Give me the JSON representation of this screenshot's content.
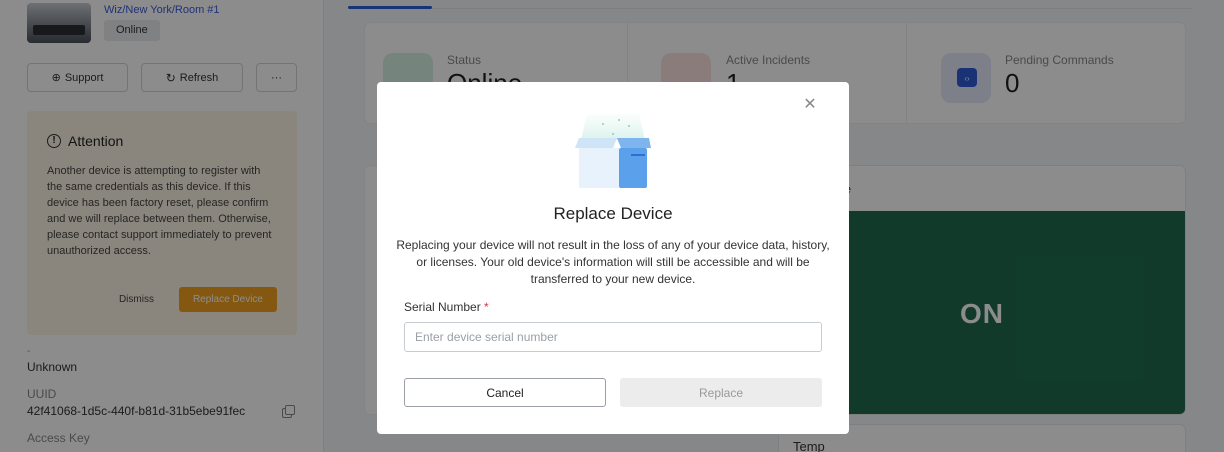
{
  "sidebar": {
    "location_link": "Wiz/New York/Room #1",
    "status_pill": "Online",
    "buttons": {
      "support": "Support",
      "refresh": "Refresh",
      "more": "···"
    },
    "attention": {
      "title": "Attention",
      "body": "Another device is attempting to register with the same credentials as this device. If this device has been factory reset, please confirm and we will replace between them. Otherwise, please contact support immediately to prevent unauthorized access.",
      "dismiss": "Dismiss",
      "replace": "Replace Device"
    },
    "meta": {
      "unknown_value": "Unknown",
      "uuid_label": "UUID",
      "uuid_value": "42f41068-1d5c-440f-b81d-31b5ebe91fec",
      "access_key_label": "Access Key"
    }
  },
  "main": {
    "stats": [
      {
        "label": "Status",
        "value": "Online"
      },
      {
        "label": "Active Incidents",
        "value": "1"
      },
      {
        "label": "Pending Commands",
        "value": "0"
      }
    ],
    "power_card": {
      "header": "e",
      "state": "ON"
    },
    "temp_card": {
      "title": "Temp"
    }
  },
  "modal": {
    "title": "Replace Device",
    "description": "Replacing your device will not result in the loss of any of your device data, history, or licenses. Your old device's information will still be accessible and will be transferred to your new device.",
    "serial_label": "Serial Number",
    "required_mark": "*",
    "serial_placeholder": "Enter device serial number",
    "serial_value": "",
    "cancel": "Cancel",
    "replace": "Replace"
  },
  "colors": {
    "accent": "#2b5bd7",
    "warning": "#f0a020",
    "power_on": "#1f6b4f",
    "required": "#e03131"
  }
}
